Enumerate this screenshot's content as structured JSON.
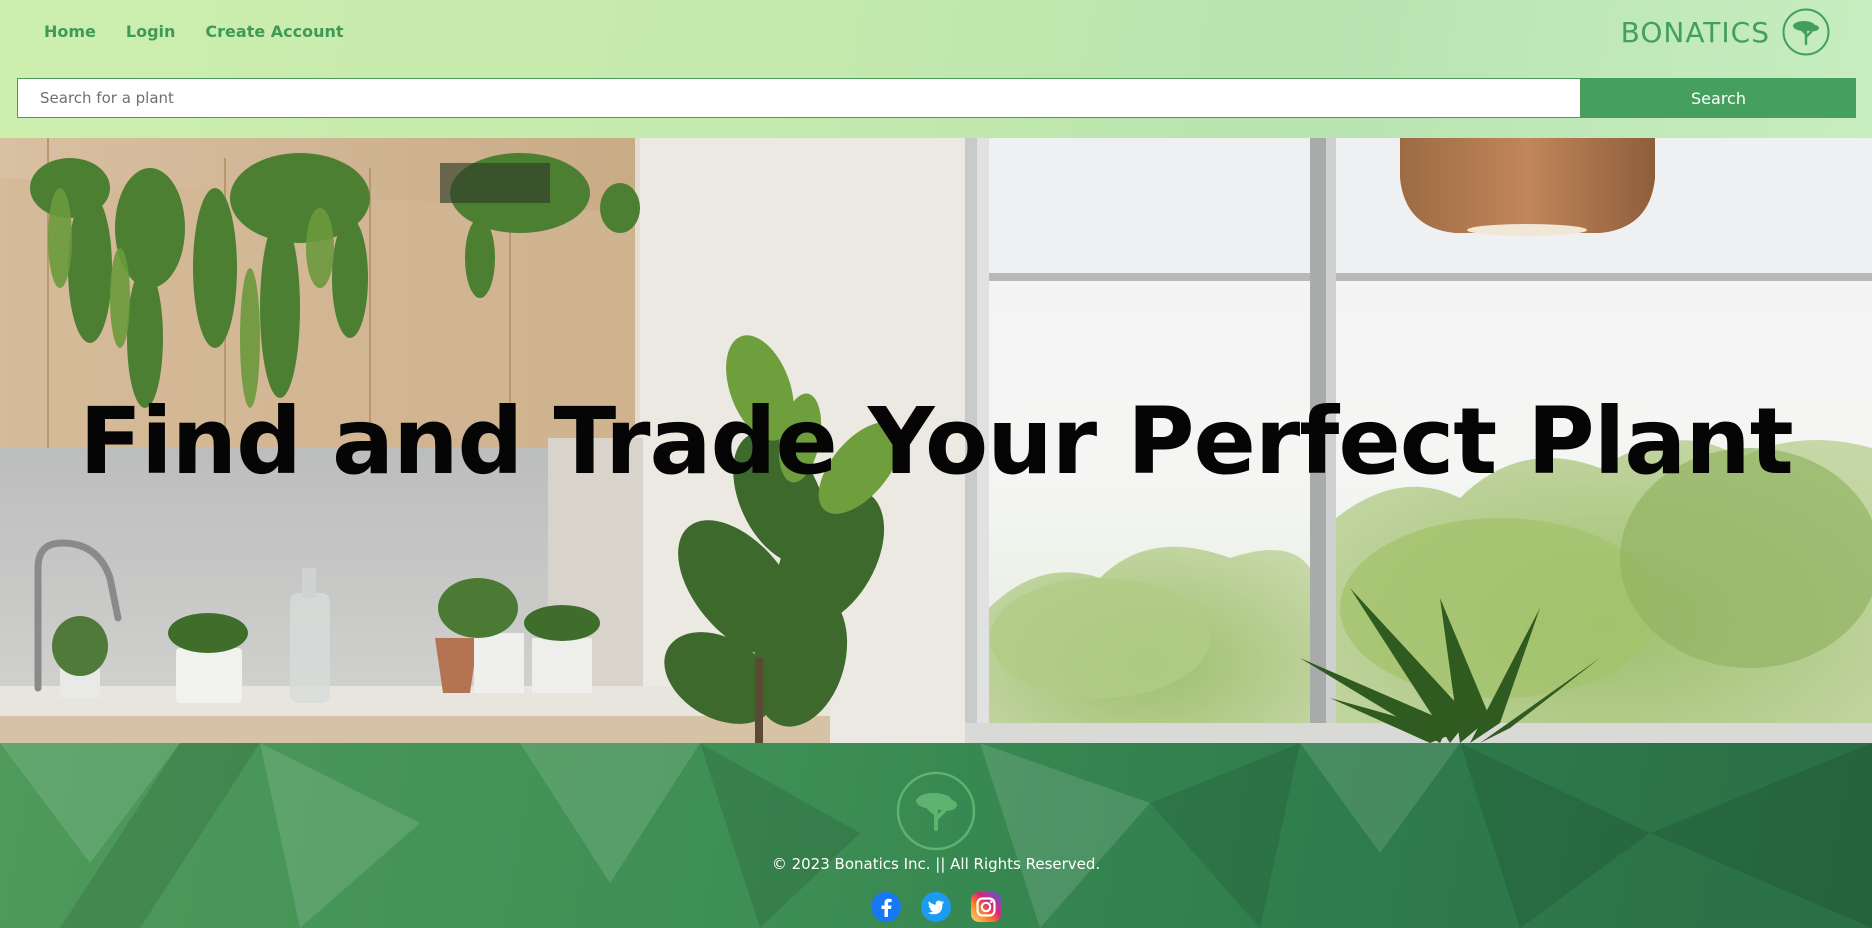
{
  "header": {
    "nav": [
      {
        "label": "Home"
      },
      {
        "label": "Login"
      },
      {
        "label": "Create Account"
      }
    ],
    "brand": "BONATICS",
    "search": {
      "placeholder": "Search for a plant",
      "value": "",
      "button_label": "Search"
    }
  },
  "hero": {
    "title": "Find and Trade Your Perfect Plant"
  },
  "footer": {
    "copyright": "© 2023 Bonatics Inc. || All Rights Reserved.",
    "socials": [
      "facebook-icon",
      "twitter-icon",
      "instagram-icon"
    ]
  },
  "colors": {
    "brand_green": "#43a05a",
    "button_green": "#46a05d",
    "footer_green": "#3e8f55",
    "header_bg": "#c9ecb0"
  }
}
